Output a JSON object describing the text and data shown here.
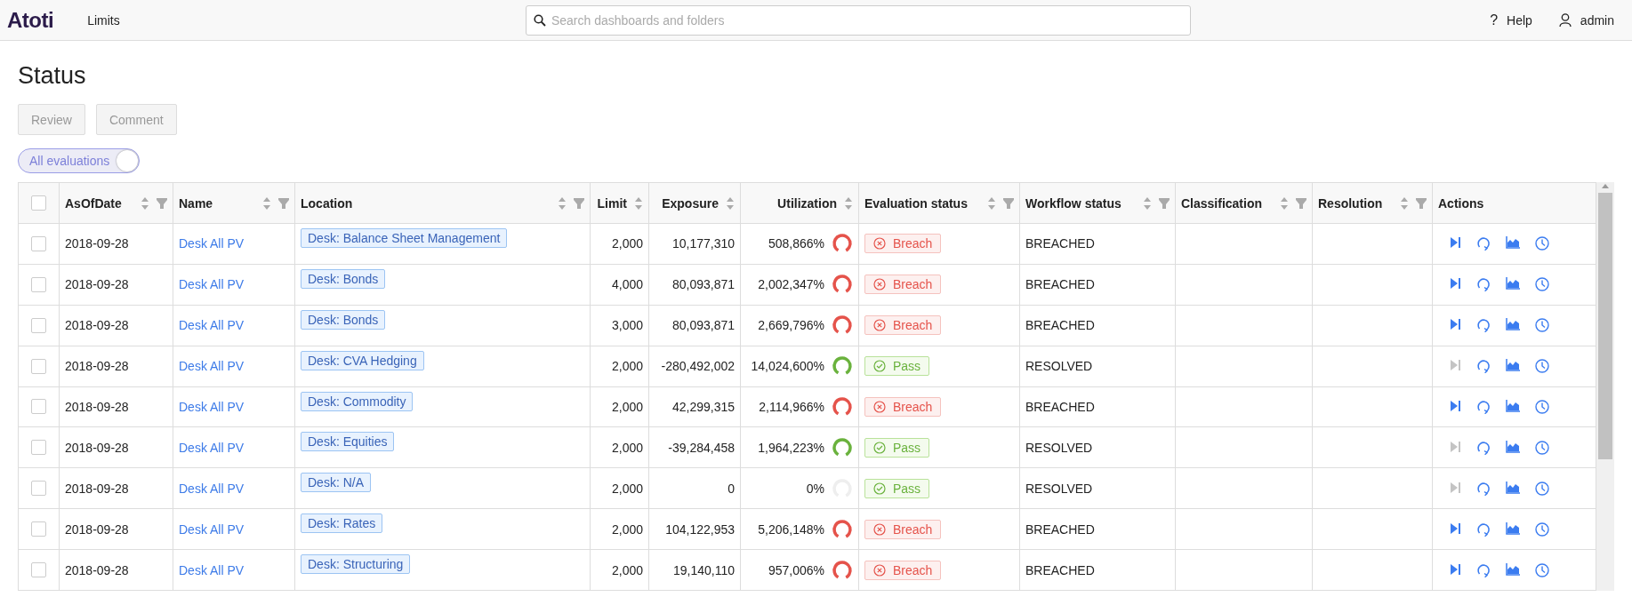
{
  "header": {
    "logo": "Atoti",
    "nav": "Limits",
    "search": {
      "placeholder": "Search dashboards and folders"
    },
    "help_glyph": "?",
    "help": "Help",
    "user": "admin"
  },
  "page": {
    "title": "Status",
    "buttons": [
      {
        "label": "Review",
        "disabled": true
      },
      {
        "label": "Comment",
        "disabled": true
      }
    ],
    "toggle": {
      "label": "All evaluations",
      "on": true
    }
  },
  "table": {
    "select_all_checked": false,
    "columns": [
      {
        "label": "AsOfDate",
        "sortable": true,
        "filterable": true
      },
      {
        "label": "Name",
        "sortable": true,
        "filterable": true
      },
      {
        "label": "Location",
        "sortable": true,
        "filterable": true
      },
      {
        "label": "Limit",
        "sortable": true,
        "filterable": false
      },
      {
        "label": "Exposure",
        "sortable": true,
        "filterable": false
      },
      {
        "label": "Utilization",
        "sortable": true,
        "filterable": false
      },
      {
        "label": "Evaluation status",
        "sortable": true,
        "filterable": true
      },
      {
        "label": "Workflow status",
        "sortable": true,
        "filterable": true
      },
      {
        "label": "Classification",
        "sortable": true,
        "filterable": true
      },
      {
        "label": "Resolution",
        "sortable": true,
        "filterable": true
      },
      {
        "label": "Actions",
        "sortable": false,
        "filterable": false
      }
    ],
    "rows": [
      {
        "checked": false,
        "date": "2018-09-28",
        "name": "Desk All PV",
        "location": "Desk: Balance Sheet Management",
        "limit": "2,000",
        "exposure": "10,177,310",
        "utilization": "508,866%",
        "gauge_filled": true,
        "evaluation": {
          "label": "Breach",
          "kind": "breach"
        },
        "workflow": "BREACHED",
        "review_disabled": false
      },
      {
        "checked": false,
        "date": "2018-09-28",
        "name": "Desk All PV",
        "location": "Desk: Bonds",
        "limit": "4,000",
        "exposure": "80,093,871",
        "utilization": "2,002,347%",
        "gauge_filled": true,
        "evaluation": {
          "label": "Breach",
          "kind": "breach"
        },
        "workflow": "BREACHED",
        "review_disabled": false
      },
      {
        "checked": false,
        "date": "2018-09-28",
        "name": "Desk All PV",
        "location": "Desk: Bonds",
        "limit": "3,000",
        "exposure": "80,093,871",
        "utilization": "2,669,796%",
        "gauge_filled": true,
        "evaluation": {
          "label": "Breach",
          "kind": "breach"
        },
        "workflow": "BREACHED",
        "review_disabled": false
      },
      {
        "checked": false,
        "date": "2018-09-28",
        "name": "Desk All PV",
        "location": "Desk: CVA Hedging",
        "limit": "2,000",
        "exposure": "-280,492,002",
        "utilization": "14,024,600%",
        "gauge_filled": true,
        "evaluation": {
          "label": "Pass",
          "kind": "pass"
        },
        "workflow": "RESOLVED",
        "review_disabled": true
      },
      {
        "checked": false,
        "date": "2018-09-28",
        "name": "Desk All PV",
        "location": "Desk: Commodity",
        "limit": "2,000",
        "exposure": "42,299,315",
        "utilization": "2,114,966%",
        "gauge_filled": true,
        "evaluation": {
          "label": "Breach",
          "kind": "breach"
        },
        "workflow": "BREACHED",
        "review_disabled": false
      },
      {
        "checked": false,
        "date": "2018-09-28",
        "name": "Desk All PV",
        "location": "Desk: Equities",
        "limit": "2,000",
        "exposure": "-39,284,458",
        "utilization": "1,964,223%",
        "gauge_filled": true,
        "evaluation": {
          "label": "Pass",
          "kind": "pass"
        },
        "workflow": "RESOLVED",
        "review_disabled": true
      },
      {
        "checked": false,
        "date": "2018-09-28",
        "name": "Desk All PV",
        "location": "Desk: N/A",
        "limit": "2,000",
        "exposure": "0",
        "utilization": "0%",
        "gauge_filled": false,
        "evaluation": {
          "label": "Pass",
          "kind": "pass"
        },
        "workflow": "RESOLVED",
        "review_disabled": true
      },
      {
        "checked": false,
        "date": "2018-09-28",
        "name": "Desk All PV",
        "location": "Desk: Rates",
        "limit": "2,000",
        "exposure": "104,122,953",
        "utilization": "5,206,148%",
        "gauge_filled": true,
        "evaluation": {
          "label": "Breach",
          "kind": "breach"
        },
        "workflow": "BREACHED",
        "review_disabled": false
      },
      {
        "checked": false,
        "date": "2018-09-28",
        "name": "Desk All PV",
        "location": "Desk: Structuring",
        "limit": "2,000",
        "exposure": "19,140,110",
        "utilization": "957,006%",
        "gauge_filled": true,
        "evaluation": {
          "label": "Breach",
          "kind": "breach"
        },
        "workflow": "BREACHED",
        "review_disabled": false
      }
    ]
  }
}
